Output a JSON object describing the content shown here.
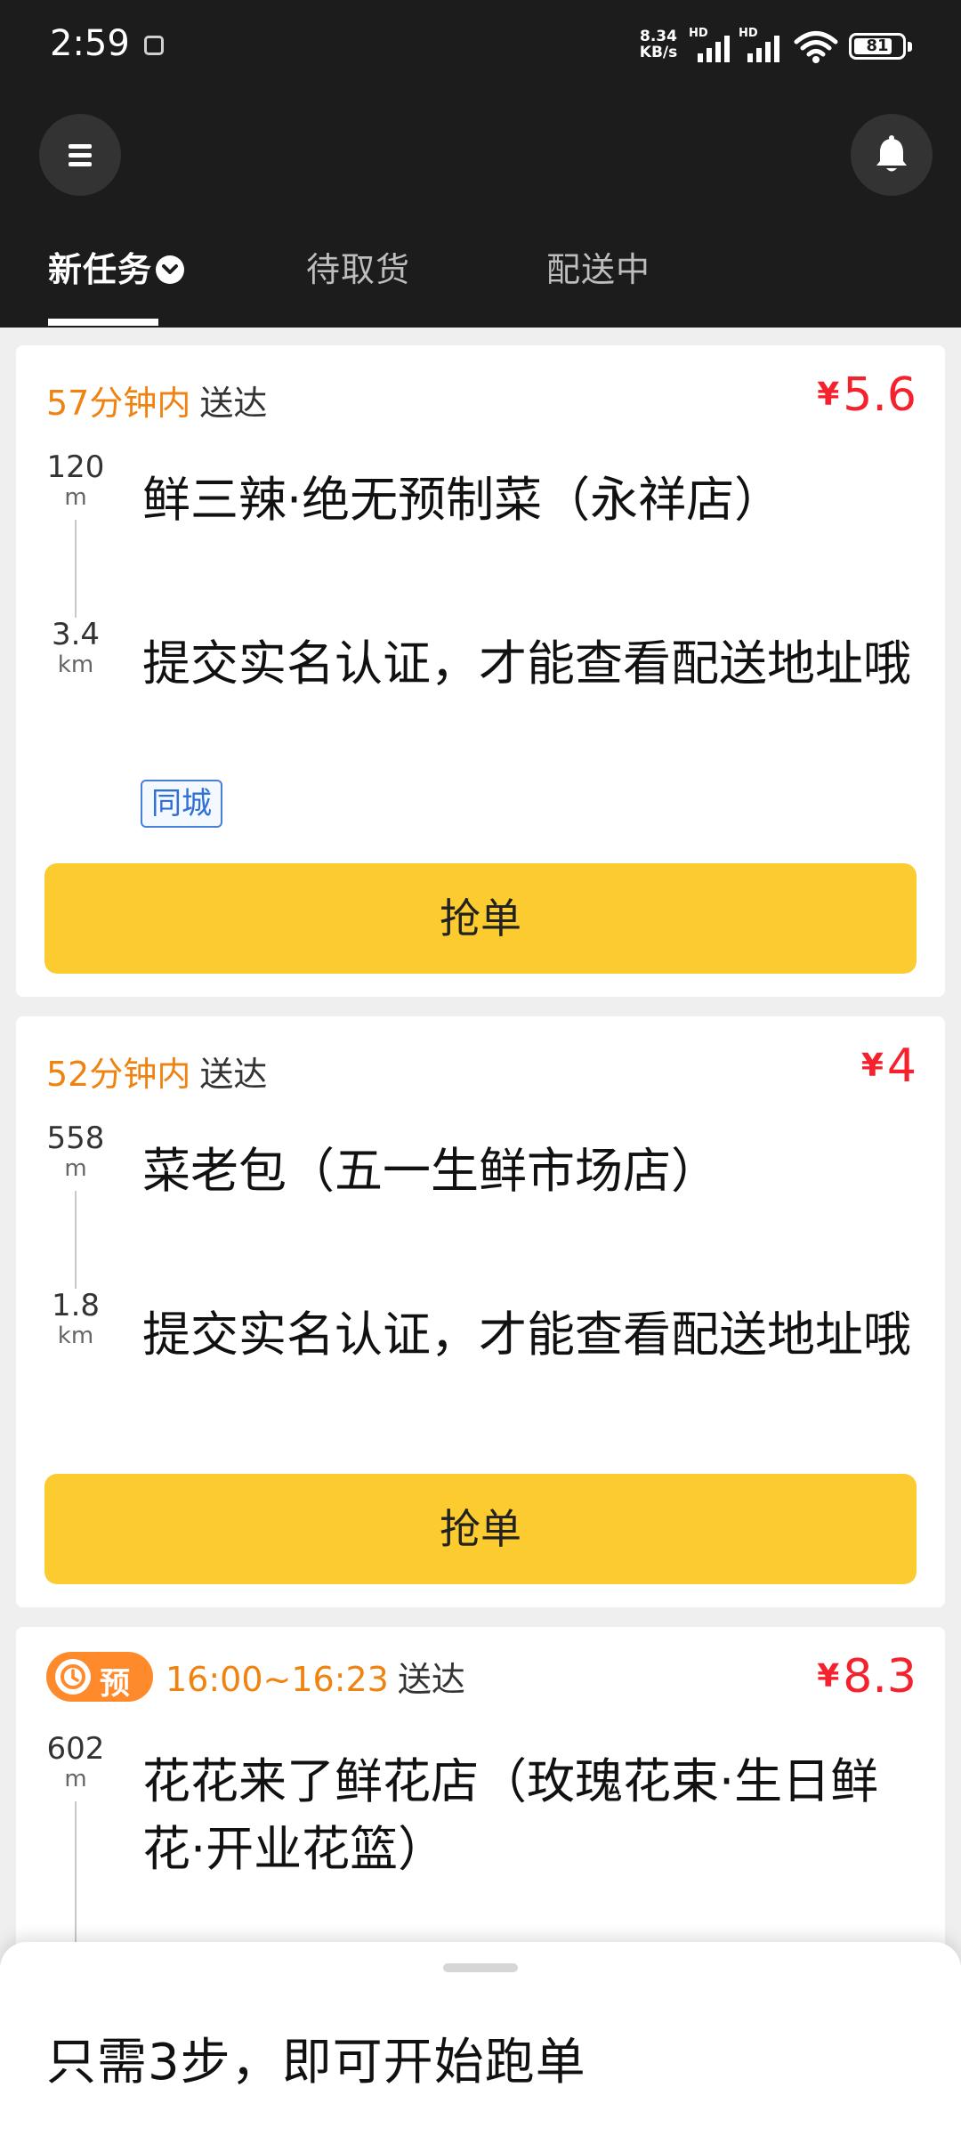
{
  "status_bar": {
    "time": "2:59",
    "net_speed_value": "8.34",
    "net_speed_unit": "KB/s",
    "hd_label": "HD",
    "battery": "81",
    "battery_level": 0.81
  },
  "tabs": [
    {
      "label": "新任务"
    },
    {
      "label": "待取货"
    },
    {
      "label": "配送中"
    }
  ],
  "orders": [
    {
      "time_limit": "57分钟内",
      "deliver_word": "送达",
      "currency": "¥",
      "price": "5.6",
      "pickup_distance": "120",
      "pickup_unit": "m",
      "pickup_name": "鲜三辣·绝无预制菜（永祥店）",
      "dropoff_distance": "3.4",
      "dropoff_unit": "km",
      "dropoff_hint": "提交实名认证，才能查看配送地址哦",
      "tag": "同城",
      "grab_label": "抢单"
    },
    {
      "time_limit": "52分钟内",
      "deliver_word": "送达",
      "currency": "¥",
      "price": "4",
      "pickup_distance": "558",
      "pickup_unit": "m",
      "pickup_name": "菜老包（五一生鲜市场店）",
      "dropoff_distance": "1.8",
      "dropoff_unit": "km",
      "dropoff_hint": "提交实名认证，才能查看配送地址哦",
      "grab_label": "抢单"
    },
    {
      "reserve_label": "预",
      "time_window": "16:00~16:23",
      "deliver_word": "送达",
      "currency": "¥",
      "price": "8.3",
      "pickup_distance": "602",
      "pickup_unit": "m",
      "pickup_name": "花花来了鲜花店（玫瑰花束·生日鲜花·开业花篮）"
    }
  ],
  "bottom_sheet": {
    "title": "只需3步，即可开始跑单"
  },
  "colors": {
    "header_bg": "#1c1c1c",
    "accent_yellow": "#fbcb2f",
    "time_orange": "#f0820f",
    "price_red": "#f5222d",
    "tag_blue": "#2f6fd6"
  },
  "icons": [
    "menu-icon",
    "bell-icon",
    "chevron-down-icon",
    "clock-icon",
    "wifi-icon",
    "signal-icon",
    "battery-icon"
  ]
}
